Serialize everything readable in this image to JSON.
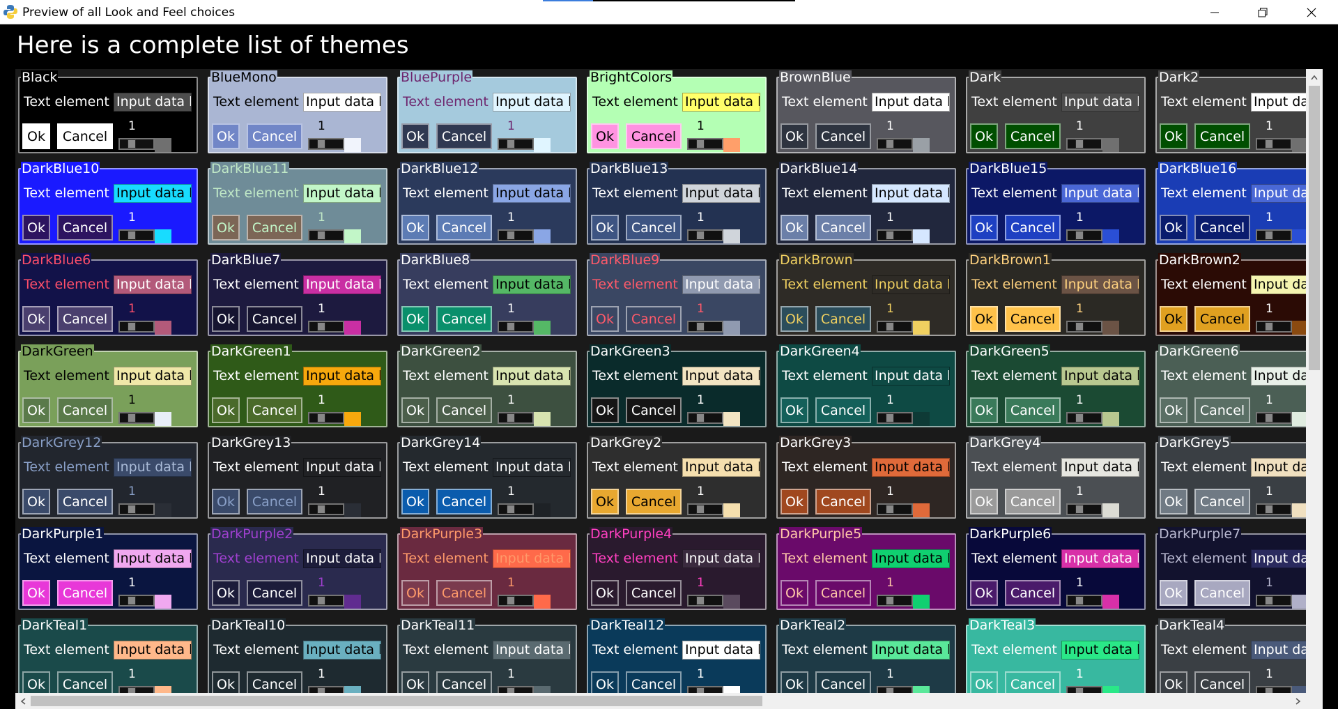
{
  "window": {
    "title": "Preview of all Look and Feel choices",
    "minimize_icon": "minimize-icon",
    "restore_icon": "restore-icon",
    "close_icon": "close-icon"
  },
  "heading": "Here is a complete list of themes",
  "labels": {
    "text": "Text element",
    "input": "Input data here",
    "ok": "Ok",
    "cancel": "Cancel",
    "slider": "1"
  },
  "themes": [
    {
      "name": "Black",
      "bg": "#000000",
      "text": "#ffffff",
      "inbg": "#4d4d4d",
      "intext": "#ffffff",
      "btnbg": "#ffffff",
      "btntext": "#000000",
      "acc": "#707070"
    },
    {
      "name": "BlueMono",
      "bg": "#aab6d3",
      "text": "#000000",
      "inbg": "#ffffff",
      "intext": "#000000",
      "btnbg": "#7186c7",
      "btntext": "#ffffff",
      "acc": "#f1f4fc"
    },
    {
      "name": "BluePurple",
      "bg": "#a5cadd",
      "text": "#6e266e",
      "inbg": "#e0f5ff",
      "intext": "#000000",
      "btnbg": "#303952",
      "btntext": "#ffffff",
      "acc": "#e0f5ff"
    },
    {
      "name": "BrightColors",
      "bg": "#b4ffb4",
      "text": "#000000",
      "inbg": "#ffff6a",
      "intext": "#000000",
      "btnbg": "#ff93e1",
      "btntext": "#000000",
      "acc": "#ff9f6a"
    },
    {
      "name": "BrownBlue",
      "bg": "#57575e",
      "text": "#ffffff",
      "inbg": "#ffffff",
      "intext": "#000000",
      "btnbg": "#2e3440",
      "btntext": "#ffffff",
      "acc": "#9aa0a6"
    },
    {
      "name": "Dark",
      "bg": "#404040",
      "text": "#ffffff",
      "inbg": "#4d4d4d",
      "intext": "#ffffff",
      "btnbg": "#004f00",
      "btntext": "#ffffff",
      "acc": "#707070"
    },
    {
      "name": "Dark2",
      "bg": "#404040",
      "text": "#ffffff",
      "inbg": "#ffffff",
      "intext": "#000000",
      "btnbg": "#004f00",
      "btntext": "#ffffff",
      "acc": "#707070"
    },
    {
      "name": "DarkBlue10",
      "bg": "#1a1aff",
      "text": "#ffffff",
      "inbg": "#18dcff",
      "intext": "#000000",
      "btnbg": "#2d1460",
      "btntext": "#ffffff",
      "acc": "#18dcff"
    },
    {
      "name": "DarkBlue11",
      "bg": "#6f8c98",
      "text": "#bfe7c6",
      "inbg": "#c2f6c8",
      "intext": "#000000",
      "btnbg": "#7c6656",
      "btntext": "#c2f6c8",
      "acc": "#c2f6c8"
    },
    {
      "name": "DarkBlue12",
      "bg": "#2b3a5c",
      "text": "#ffffff",
      "inbg": "#8aa6e5",
      "intext": "#000000",
      "btnbg": "#5c7bb4",
      "btntext": "#ffffff",
      "acc": "#8aa6e5"
    },
    {
      "name": "DarkBlue13",
      "bg": "#233252",
      "text": "#ffffff",
      "inbg": "#d0d5db",
      "intext": "#000000",
      "btnbg": "#3d5482",
      "btntext": "#ffffff",
      "acc": "#d0d5db"
    },
    {
      "name": "DarkBlue14",
      "bg": "#21273d",
      "text": "#ffffff",
      "inbg": "#d5e7ff",
      "intext": "#000000",
      "btnbg": "#6b7fa8",
      "btntext": "#ffffff",
      "acc": "#d5e7ff"
    },
    {
      "name": "DarkBlue15",
      "bg": "#0c1866",
      "text": "#ffffff",
      "inbg": "#4a67d6",
      "intext": "#ffffff",
      "btnbg": "#1e40c2",
      "btntext": "#ffffff",
      "acc": "#2a4fd6"
    },
    {
      "name": "DarkBlue16",
      "bg": "#1a3db5",
      "text": "#ffffff",
      "inbg": "#4a68d6",
      "intext": "#ffffff",
      "btnbg": "#0a1c6e",
      "btntext": "#ffffff",
      "acc": "#2a4fd6"
    },
    {
      "name": "DarkBlue6",
      "bg": "#121249",
      "text": "#ff4f6a",
      "inbg": "#b35a7a",
      "intext": "#ffffff",
      "btnbg": "#4a3f6e",
      "btntext": "#ffffff",
      "acc": "#b35a7a"
    },
    {
      "name": "DarkBlue7",
      "bg": "#1d1a3f",
      "text": "#ffffff",
      "inbg": "#c92fa3",
      "intext": "#ffffff",
      "btnbg": "#161430",
      "btntext": "#ffffff",
      "acc": "#c92fa3"
    },
    {
      "name": "DarkBlue8",
      "bg": "#373d5e",
      "text": "#ffffff",
      "inbg": "#55b866",
      "intext": "#000000",
      "btnbg": "#0a8f6b",
      "btntext": "#ffffff",
      "acc": "#55b866"
    },
    {
      "name": "DarkBlue9",
      "bg": "#3a4763",
      "text": "#ff5a6a",
      "inbg": "#909ab0",
      "intext": "#ffffff",
      "btnbg": "#3a4763",
      "btntext": "#ff5a6a",
      "acc": "#909ab0"
    },
    {
      "name": "DarkBrown",
      "bg": "#2e2b26",
      "text": "#f0d060",
      "inbg": "#2e2b26",
      "intext": "#f0d060",
      "btnbg": "#2b4d5b",
      "btntext": "#f0d060",
      "acc": "#f0d060"
    },
    {
      "name": "DarkBrown1",
      "bg": "#2b2924",
      "text": "#ffd27f",
      "inbg": "#6b5345",
      "intext": "#ffd27f",
      "btnbg": "#ffc24a",
      "btntext": "#000000",
      "acc": "#6b5345"
    },
    {
      "name": "DarkBrown2",
      "bg": "#2b0b05",
      "text": "#ffffff",
      "inbg": "#f5f5b0",
      "intext": "#000000",
      "btnbg": "#e0a020",
      "btntext": "#000000",
      "acc": "#8a4a10"
    },
    {
      "name": "DarkGreen",
      "bg": "#7aa05a",
      "text": "#000000",
      "inbg": "#f0e8a8",
      "intext": "#000000",
      "btnbg": "#5a7a4a",
      "btntext": "#ffffff",
      "acc": "#e8eef8"
    },
    {
      "name": "DarkGreen1",
      "bg": "#2f5a18",
      "text": "#ffffff",
      "inbg": "#f7a80d",
      "intext": "#000000",
      "btnbg": "#4a6a2a",
      "btntext": "#ffffff",
      "acc": "#f7a80d"
    },
    {
      "name": "DarkGreen2",
      "bg": "#3d5040",
      "text": "#ffffff",
      "inbg": "#d8e4b0",
      "intext": "#000000",
      "btnbg": "#4b5e4a",
      "btntext": "#ffffff",
      "acc": "#d8e4b0"
    },
    {
      "name": "DarkGreen3",
      "bg": "#0a2b2b",
      "text": "#ffffff",
      "inbg": "#f2e4c2",
      "intext": "#000000",
      "btnbg": "#151515",
      "btntext": "#ffffff",
      "acc": "#f2e4c2"
    },
    {
      "name": "DarkGreen4",
      "bg": "#0e4a44",
      "text": "#ffffff",
      "inbg": "#0e4a44",
      "intext": "#ffffff",
      "btnbg": "#14605a",
      "btntext": "#ffffff",
      "acc": "#0e3a36"
    },
    {
      "name": "DarkGreen5",
      "bg": "#1b4a33",
      "text": "#ffffff",
      "inbg": "#b8c890",
      "intext": "#000000",
      "btnbg": "#3a7a5a",
      "btntext": "#ffffff",
      "acc": "#b8c890"
    },
    {
      "name": "DarkGreen6",
      "bg": "#4b5f55",
      "text": "#ffffff",
      "inbg": "#e8f0e8",
      "intext": "#000000",
      "btnbg": "#5a6f65",
      "btntext": "#ffffff",
      "acc": "#e0ece0"
    },
    {
      "name": "DarkGrey12",
      "bg": "#22262e",
      "text": "#8aa0c8",
      "inbg": "#3a4a6a",
      "intext": "#aabbd8",
      "btnbg": "#3a4a6a",
      "btntext": "#ffffff",
      "acc": "#2a2e36"
    },
    {
      "name": "DarkGrey13",
      "bg": "#202124",
      "text": "#ffffff",
      "inbg": "#202124",
      "intext": "#ffffff",
      "btnbg": "#3a4a6a",
      "btntext": "#8aa0c8",
      "acc": "#2a2e36"
    },
    {
      "name": "DarkGrey14",
      "bg": "#24292e",
      "text": "#ffffff",
      "inbg": "#24292e",
      "intext": "#ffffff",
      "btnbg": "#0b5cad",
      "btntext": "#ffffff",
      "acc": "#1e2226"
    },
    {
      "name": "DarkGrey2",
      "bg": "#2e2e2e",
      "text": "#ffffff",
      "inbg": "#f5dfae",
      "intext": "#000000",
      "btnbg": "#e8a830",
      "btntext": "#000000",
      "acc": "#f5dfae"
    },
    {
      "name": "DarkGrey3",
      "bg": "#2e2623",
      "text": "#ffffff",
      "inbg": "#e06a3a",
      "intext": "#000000",
      "btnbg": "#a0481f",
      "btntext": "#ffffff",
      "acc": "#e06a3a"
    },
    {
      "name": "DarkGrey4",
      "bg": "#4b4f53",
      "text": "#ffffff",
      "inbg": "#e6e6e0",
      "intext": "#000000",
      "btnbg": "#9a9a9a",
      "btntext": "#ffffff",
      "acc": "#dcdcd4"
    },
    {
      "name": "DarkGrey5",
      "bg": "#3a3f44",
      "text": "#ffffff",
      "inbg": "#f0e0c0",
      "intext": "#000000",
      "btnbg": "#707a84",
      "btntext": "#ffffff",
      "acc": "#f0e0c0"
    },
    {
      "name": "DarkPurple1",
      "bg": "#0a1540",
      "text": "#ffffff",
      "inbg": "#f0a8f0",
      "intext": "#000000",
      "btnbg": "#e838d8",
      "btntext": "#ffffff",
      "acc": "#f0a8f0"
    },
    {
      "name": "DarkPurple2",
      "bg": "#2a2a4e",
      "text": "#a040d0",
      "inbg": "#1c1c3a",
      "intext": "#ffffff",
      "btnbg": "#1c1c3a",
      "btntext": "#ffffff",
      "acc": "#602c90"
    },
    {
      "name": "DarkPurple3",
      "bg": "#6a2a40",
      "text": "#ff9a6a",
      "inbg": "#ff6a4a",
      "intext": "#ff9a6a",
      "btnbg": "#7a3a4e",
      "btntext": "#ff9a6a",
      "acc": "#ff6a4a"
    },
    {
      "name": "DarkPurple4",
      "bg": "#2a1a2e",
      "text": "#ff40c0",
      "inbg": "#3a2a3e",
      "intext": "#ffffff",
      "btnbg": "#2a1a2e",
      "btntext": "#ffffff",
      "acc": "#5a4a5e"
    },
    {
      "name": "DarkPurple5",
      "bg": "#6a0a6a",
      "text": "#ffc8a8",
      "inbg": "#10d070",
      "intext": "#000000",
      "btnbg": "#6a0a6a",
      "btntext": "#ffc8a8",
      "acc": "#10d070"
    },
    {
      "name": "DarkPurple6",
      "bg": "#08093a",
      "text": "#ffffff",
      "inbg": "#d830a8",
      "intext": "#ffffff",
      "btnbg": "#4a1a6a",
      "btntext": "#ffffff",
      "acc": "#d830a8"
    },
    {
      "name": "DarkPurple7",
      "bg": "#12122e",
      "text": "#b8b8d0",
      "inbg": "#2a2a5e",
      "intext": "#ffffff",
      "btnbg": "#a8a8c0",
      "btntext": "#ffffff",
      "acc": "#b0b0c8"
    },
    {
      "name": "DarkTeal1",
      "bg": "#1a4a4a",
      "text": "#ffffff",
      "inbg": "#ffb88a",
      "intext": "#000000",
      "btnbg": "#1a4a4a",
      "btntext": "#ffffff",
      "acc": "#ffb88a"
    },
    {
      "name": "DarkTeal10",
      "bg": "#1e2a30",
      "text": "#ffffff",
      "inbg": "#6ab0c0",
      "intext": "#000000",
      "btnbg": "#1e2a30",
      "btntext": "#ffffff",
      "acc": "#6ab0c0"
    },
    {
      "name": "DarkTeal11",
      "bg": "#2a3a40",
      "text": "#ffffff",
      "inbg": "#5a6a70",
      "intext": "#ffffff",
      "btnbg": "#2a3a40",
      "btntext": "#ffffff",
      "acc": "#5a6a70"
    },
    {
      "name": "DarkTeal12",
      "bg": "#0a3a5a",
      "text": "#ffffff",
      "inbg": "#ffffff",
      "intext": "#000000",
      "btnbg": "#0a3a5a",
      "btntext": "#ffffff",
      "acc": "#ffffff"
    },
    {
      "name": "DarkTeal2",
      "bg": "#1e3a46",
      "text": "#ffffff",
      "inbg": "#5ae89a",
      "intext": "#000000",
      "btnbg": "#1e3a46",
      "btntext": "#ffffff",
      "acc": "#5ae89a"
    },
    {
      "name": "DarkTeal3",
      "bg": "#38b8a0",
      "text": "#ffffff",
      "inbg": "#2ae888",
      "intext": "#000000",
      "btnbg": "#38b8a0",
      "btntext": "#ffffff",
      "acc": "#2ae888"
    },
    {
      "name": "DarkTeal4",
      "bg": "#3a3f44",
      "text": "#ffffff",
      "inbg": "#4a5a7a",
      "intext": "#ffffff",
      "btnbg": "#3a3f44",
      "btntext": "#ffffff",
      "acc": "#4a5a7a"
    }
  ]
}
